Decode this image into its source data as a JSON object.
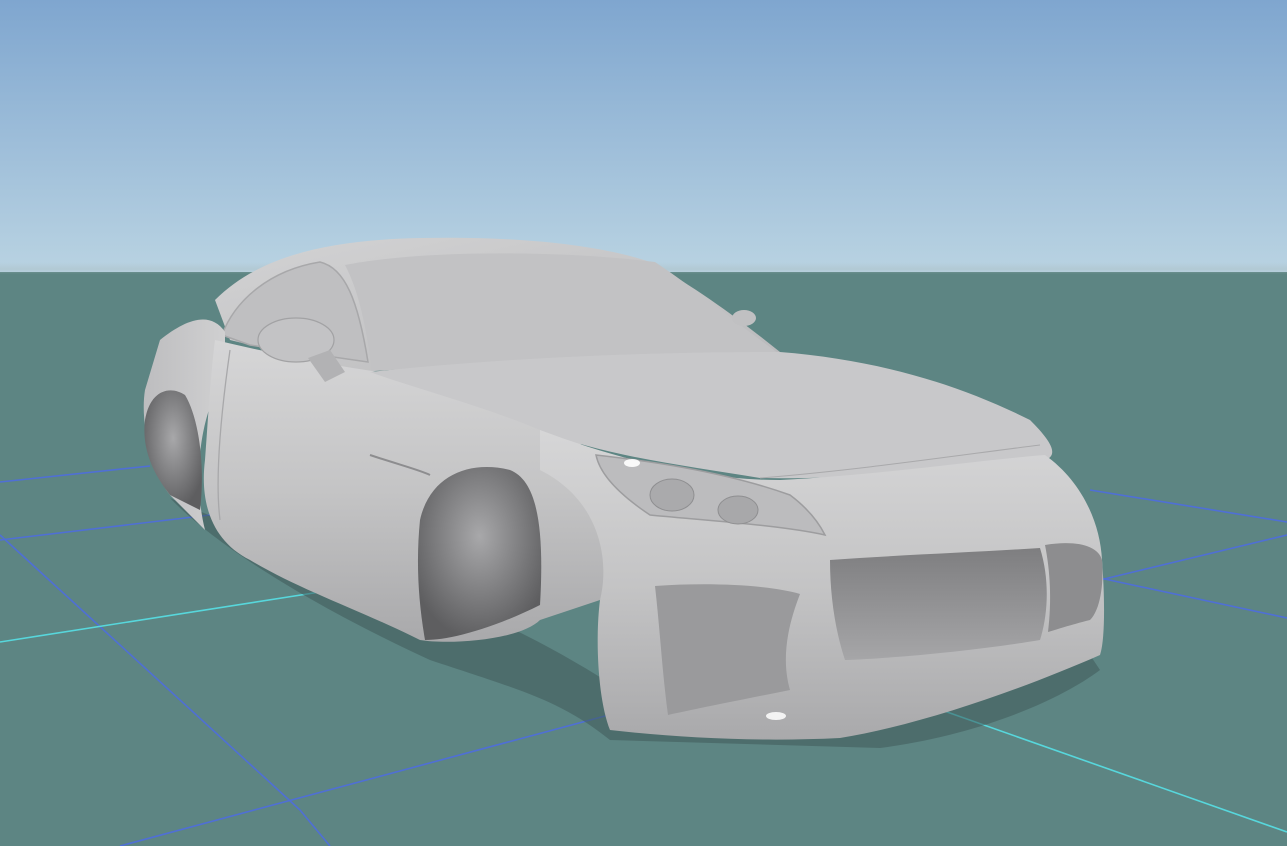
{
  "scene": {
    "colors": {
      "sky_top": "#7fa6cf",
      "sky_horizon": "#b9d3e2",
      "ground": "#5d8583",
      "grid_line": "#4f6fd6",
      "axis_x": "#57d7dc",
      "car_body": "#c9c9ca",
      "car_shadow": "#3f5a59"
    },
    "objects": {
      "car_model": "car-body",
      "ground_plane": "ground-plane",
      "grid": "reference-grid"
    }
  }
}
